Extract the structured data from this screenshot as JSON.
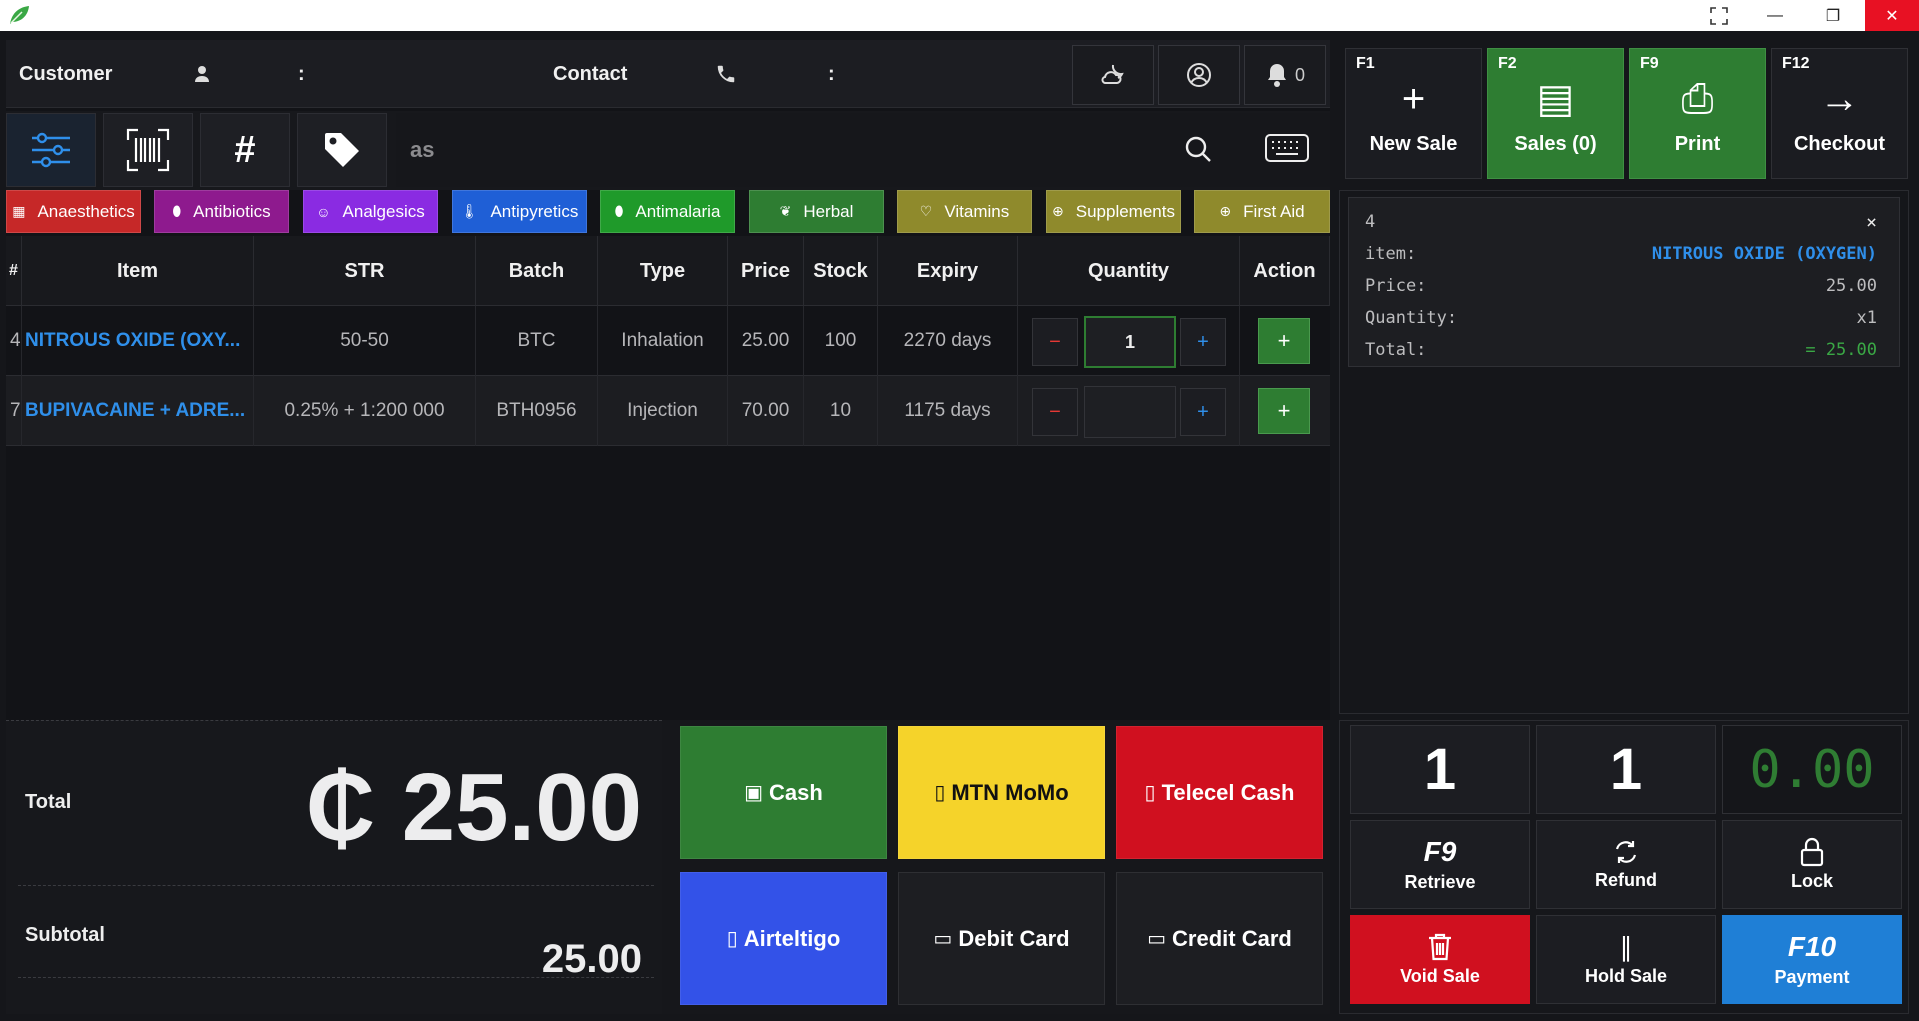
{
  "window": {
    "minimize": "—",
    "restore": "❐",
    "close": "✕",
    "fullscreen": "⛶"
  },
  "customer_bar": {
    "customer_label": "Customer",
    "customer_sep": ":",
    "contact_label": "Contact",
    "contact_sep": ":",
    "notification_count": "0"
  },
  "search": {
    "value": "as"
  },
  "categories": [
    {
      "label": "Anaesthetics",
      "color": "#c62828",
      "icon": "grid-icon"
    },
    {
      "label": "Antibiotics",
      "color": "#8e1a8e",
      "icon": "pill-icon"
    },
    {
      "label": "Analgesics",
      "color": "#8a2be2",
      "icon": "smile-icon"
    },
    {
      "label": "Antipyretics",
      "color": "#1f5fd6",
      "icon": "thermometer-icon"
    },
    {
      "label": "Antimalaria",
      "color": "#1f9a2a",
      "icon": "pill-icon"
    },
    {
      "label": "Herbal",
      "color": "#2e7d32",
      "icon": "leaf-icon"
    },
    {
      "label": "Vitamins",
      "color": "#8f8a2c",
      "icon": "heart-icon"
    },
    {
      "label": "Supplements",
      "color": "#8f8a2c",
      "icon": "plus-circle-icon"
    },
    {
      "label": "First Aid",
      "color": "#8f8a2c",
      "icon": "plus-circle-icon"
    }
  ],
  "table": {
    "headers": [
      "#",
      "Item",
      "STR",
      "Batch",
      "Type",
      "Price",
      "Stock",
      "Expiry",
      "Quantity",
      "Action"
    ],
    "rows": [
      {
        "id": "4",
        "item": "NITROUS OXIDE (OXY...",
        "str": "50-50",
        "batch": "BTC",
        "type": "Inhalation",
        "price": "25.00",
        "stock": "100",
        "expiry": "2270 days",
        "quantity": "1",
        "minus": "−",
        "plus": "+",
        "action": "+"
      },
      {
        "id": "7",
        "item": "BUPIVACAINE + ADRE...",
        "str": "0.25% + 1:200 000",
        "batch": "BTH0956",
        "type": "Injection",
        "price": "70.00",
        "stock": "10",
        "expiry": "1175 days",
        "quantity": "",
        "minus": "−",
        "plus": "+",
        "action": "+"
      }
    ]
  },
  "totals": {
    "total_label": "Total",
    "total_value": "₵ 25.00",
    "subtotal_label": "Subtotal",
    "subtotal_value": "25.00"
  },
  "payments": [
    {
      "label": "Cash",
      "color": "#2e7d32",
      "text_color": "#ffffff",
      "icon": "cash-icon"
    },
    {
      "label": "MTN MoMo",
      "color": "#f5d32a",
      "text_color": "#111111",
      "icon": "phone-icon"
    },
    {
      "label": "Telecel Cash",
      "color": "#d0101f",
      "text_color": "#ffffff",
      "icon": "phone-icon"
    },
    {
      "label": "Airteltigo",
      "color": "#3352e8",
      "text_color": "#ffffff",
      "icon": "phone-icon"
    },
    {
      "label": "Debit Card",
      "color": "#1d1e22",
      "text_color": "#ffffff",
      "icon": "card-icon"
    },
    {
      "label": "Credit Card",
      "color": "#1d1e22",
      "text_color": "#ffffff",
      "icon": "card-icon"
    }
  ],
  "function_buttons": [
    {
      "key": "F1",
      "label": "New Sale",
      "icon": "plus-icon"
    },
    {
      "key": "F2",
      "label": "Sales (0)",
      "icon": "receipt-icon"
    },
    {
      "key": "F9",
      "label": "Print",
      "icon": "printer-icon"
    },
    {
      "key": "F12",
      "label": "Checkout",
      "icon": "arrow-right-icon"
    }
  ],
  "receipt": {
    "id": "4",
    "item_label": "item:",
    "item_value": "NITROUS OXIDE (OXYGEN)",
    "price_label": "Price:",
    "price_value": "25.00",
    "quantity_label": "Quantity:",
    "quantity_value": "x1",
    "total_label": "Total:",
    "total_value": "= 25.00",
    "close": "×"
  },
  "numpad": {
    "display1": "1",
    "display2": "1",
    "amount": "0.00",
    "retrieve_key": "F9",
    "retrieve_label": "Retrieve",
    "refund_label": "Refund",
    "lock_label": "Lock",
    "void_label": "Void Sale",
    "hold_label": "Hold Sale",
    "payment_key": "F10",
    "payment_label": "Payment"
  }
}
